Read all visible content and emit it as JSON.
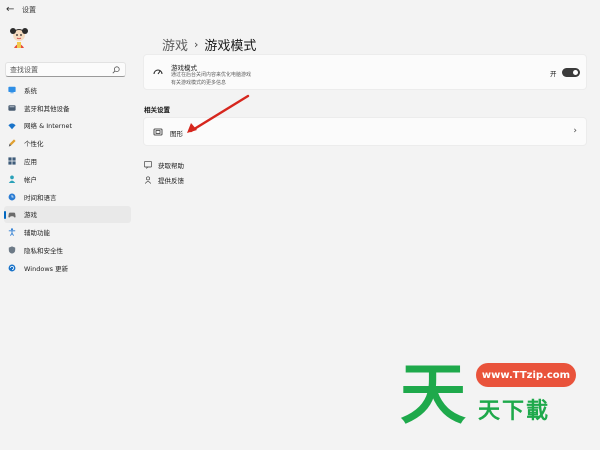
{
  "window": {
    "title": "设置"
  },
  "search": {
    "placeholder": "查找设置"
  },
  "nav": {
    "items": [
      {
        "label": "系统",
        "icon": "monitor-icon",
        "selected": false
      },
      {
        "label": "蓝牙和其他设备",
        "icon": "bluetooth-icon",
        "selected": false
      },
      {
        "label": "网络 & Internet",
        "icon": "wifi-icon",
        "selected": false
      },
      {
        "label": "个性化",
        "icon": "brush-icon",
        "selected": false
      },
      {
        "label": "应用",
        "icon": "apps-icon",
        "selected": false
      },
      {
        "label": "帐户",
        "icon": "person-icon",
        "selected": false
      },
      {
        "label": "时间和语言",
        "icon": "globe-clock-icon",
        "selected": false
      },
      {
        "label": "游戏",
        "icon": "gamepad-icon",
        "selected": true
      },
      {
        "label": "辅助功能",
        "icon": "accessibility-icon",
        "selected": false
      },
      {
        "label": "隐私和安全性",
        "icon": "shield-icon",
        "selected": false
      },
      {
        "label": "Windows 更新",
        "icon": "update-icon",
        "selected": false
      }
    ]
  },
  "breadcrumb": {
    "parent": "游戏",
    "separator": "›",
    "current": "游戏模式"
  },
  "game_mode_card": {
    "title": "游戏模式",
    "desc_line1": "通过在后台关闭内容来优化电脑游戏",
    "desc_line2": "有关游戏模式的更多信息",
    "toggle_label": "开",
    "toggle_on": true
  },
  "related": {
    "heading": "相关设置",
    "graphics_label": "图形",
    "chevron": "›"
  },
  "help_links": {
    "get_help": "获取帮助",
    "feedback": "提供反馈"
  },
  "watermark": {
    "url": "www.TTzip.com",
    "text": "天下載",
    "big_char": "天"
  },
  "colors": {
    "accent": "#0067c0",
    "arrow": "#d6261d",
    "wm_green": "#1ea94b",
    "wm_red": "#e9533b"
  }
}
